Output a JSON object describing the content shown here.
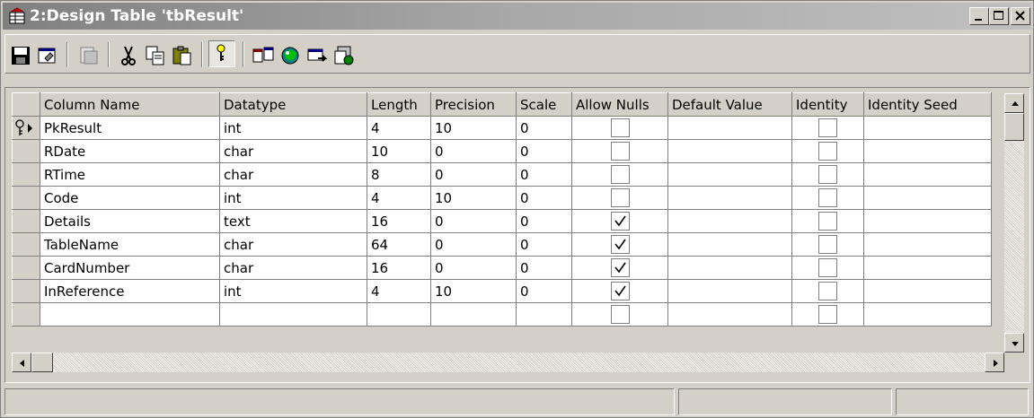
{
  "window": {
    "title": "2:Design Table 'tbResult'",
    "icon": "table-design-icon",
    "buttons": [
      "minimize-icon",
      "maximize-icon",
      "close-icon"
    ]
  },
  "toolbar": {
    "icons": [
      "save-icon",
      "properties-icon",
      "generate-script-icon",
      "cut-icon",
      "copy-icon",
      "paste-icon",
      "primary-key-icon",
      "manage-relationships-icon",
      "manage-indexes-icon",
      "manage-constraints-icon",
      "manage-triggers-icon"
    ]
  },
  "grid": {
    "columns": [
      "Column Name",
      "Datatype",
      "Length",
      "Precision",
      "Scale",
      "Allow Nulls",
      "Default Value",
      "Identity",
      "Identity Seed"
    ],
    "rows": [
      {
        "name": "PkResult",
        "datatype": "int",
        "length": "4",
        "precision": "10",
        "scale": "0",
        "allow_nulls": false,
        "default_value": "",
        "identity": false,
        "identity_seed": "",
        "primary_key": true,
        "current": true
      },
      {
        "name": "RDate",
        "datatype": "char",
        "length": "10",
        "precision": "0",
        "scale": "0",
        "allow_nulls": false,
        "default_value": "",
        "identity": false,
        "identity_seed": ""
      },
      {
        "name": "RTime",
        "datatype": "char",
        "length": "8",
        "precision": "0",
        "scale": "0",
        "allow_nulls": false,
        "default_value": "",
        "identity": false,
        "identity_seed": ""
      },
      {
        "name": "Code",
        "datatype": "int",
        "length": "4",
        "precision": "10",
        "scale": "0",
        "allow_nulls": false,
        "default_value": "",
        "identity": false,
        "identity_seed": ""
      },
      {
        "name": "Details",
        "datatype": "text",
        "length": "16",
        "precision": "0",
        "scale": "0",
        "allow_nulls": true,
        "default_value": "",
        "identity": false,
        "identity_seed": ""
      },
      {
        "name": "TableName",
        "datatype": "char",
        "length": "64",
        "precision": "0",
        "scale": "0",
        "allow_nulls": true,
        "default_value": "",
        "identity": false,
        "identity_seed": ""
      },
      {
        "name": "CardNumber",
        "datatype": "char",
        "length": "16",
        "precision": "0",
        "scale": "0",
        "allow_nulls": true,
        "default_value": "",
        "identity": false,
        "identity_seed": ""
      },
      {
        "name": "InReference",
        "datatype": "int",
        "length": "4",
        "precision": "10",
        "scale": "0",
        "allow_nulls": true,
        "default_value": "",
        "identity": false,
        "identity_seed": ""
      },
      {
        "name": "",
        "datatype": "",
        "length": "",
        "precision": "",
        "scale": "",
        "allow_nulls": false,
        "default_value": "",
        "identity": false,
        "identity_seed": ""
      }
    ]
  },
  "statusbar": {
    "panels": [
      "",
      "",
      ""
    ]
  }
}
